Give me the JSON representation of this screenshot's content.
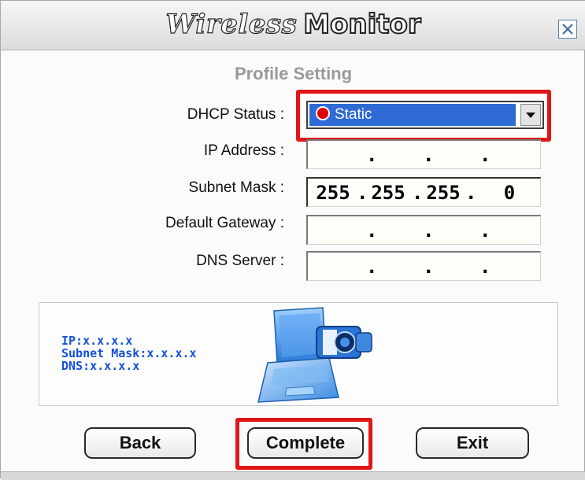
{
  "window": {
    "title_brand": "Wireless",
    "title_word": "Monitor",
    "subtitle": "Profile Setting"
  },
  "form": {
    "dhcp_label": "DHCP Status :",
    "dhcp_value": "Static",
    "ip_label": "IP Address :",
    "ip_value": [
      "",
      "",
      "",
      ""
    ],
    "mask_label": "Subnet Mask :",
    "mask_value": [
      "255",
      "255",
      "255",
      "0"
    ],
    "gateway_label": "Default Gateway :",
    "gateway_value": [
      "",
      "",
      "",
      ""
    ],
    "dns_label": "DNS Server :",
    "dns_value": [
      "",
      "",
      "",
      ""
    ]
  },
  "info": {
    "lines": [
      "IP:x.x.x.x",
      "Subnet Mask:x.x.x.x",
      "DNS:x.x.x.x"
    ]
  },
  "buttons": {
    "back": "Back",
    "complete": "Complete",
    "exit": "Exit"
  },
  "colors": {
    "highlight": "#e01616",
    "select_bg": "#2f6bd4",
    "info_text": "#1450d8"
  },
  "icons": [
    "close-icon",
    "dropdown-arrow-icon",
    "red-dot-icon",
    "laptop-camera-icon"
  ]
}
